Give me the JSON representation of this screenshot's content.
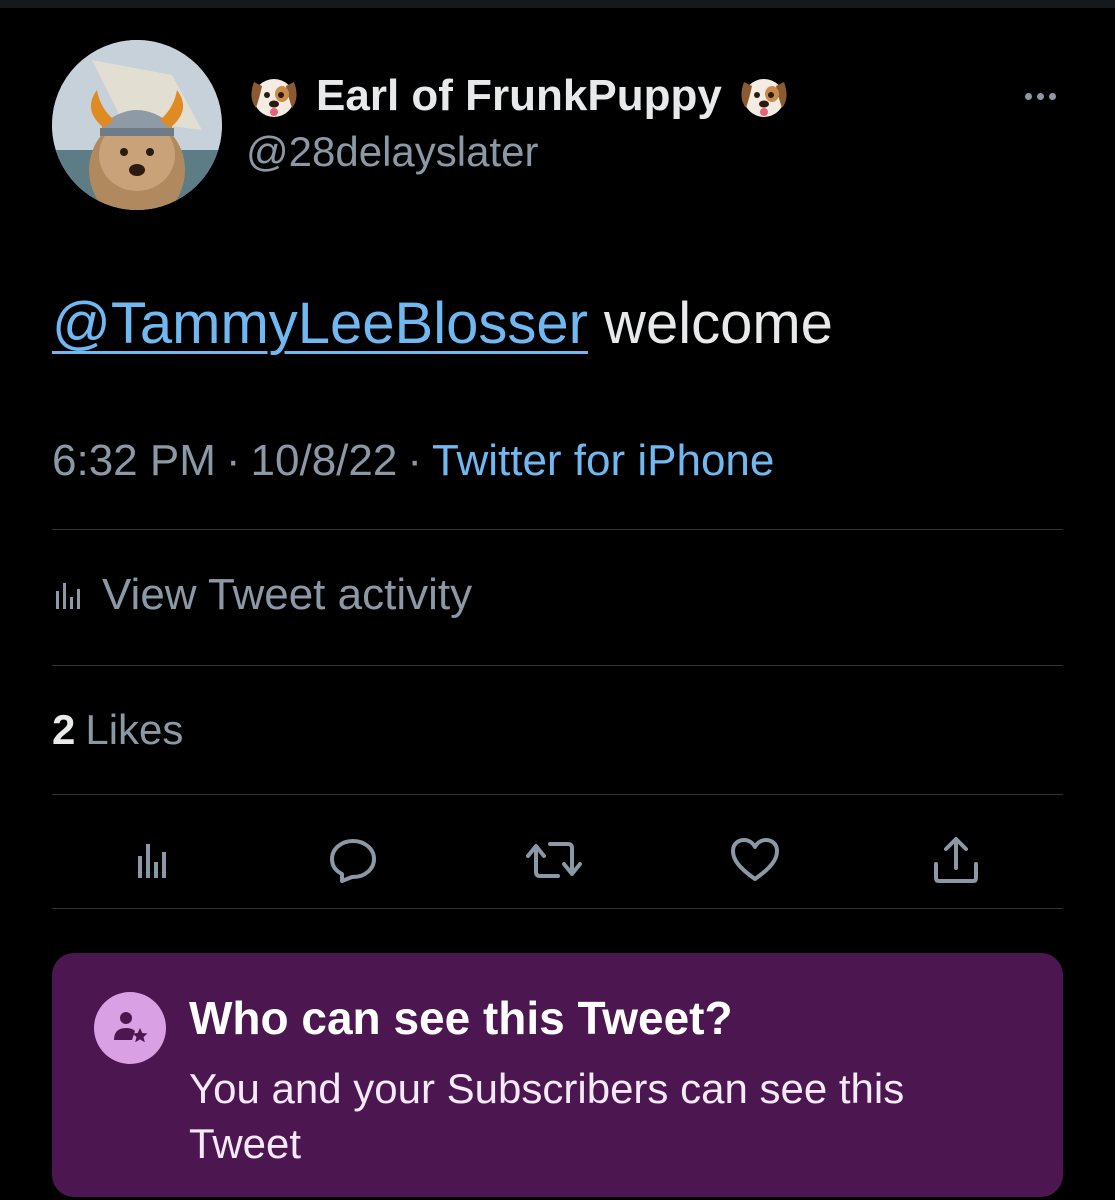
{
  "author": {
    "name_prefix_emoji": "dog-face",
    "display_name": "Earl of FrunkPuppy",
    "name_suffix_emoji": "dog-face",
    "handle": "@28delayslater"
  },
  "more_icon": "more-horizontal-icon",
  "tweet": {
    "mention": "@TammyLeeBlosser",
    "text": " welcome"
  },
  "meta": {
    "time": "6:32 PM",
    "separator": "·",
    "date": "10/8/22",
    "source": "Twitter for iPhone"
  },
  "activity": {
    "icon": "analytics-icon",
    "label": "View Tweet activity"
  },
  "likes": {
    "count": "2",
    "label": "Likes"
  },
  "actions": [
    {
      "icon": "analytics-icon"
    },
    {
      "icon": "reply-icon"
    },
    {
      "icon": "retweet-icon"
    },
    {
      "icon": "like-icon"
    },
    {
      "icon": "share-icon"
    }
  ],
  "audience": {
    "icon": "subscriber-icon",
    "title": "Who can see this Tweet?",
    "description": "You and your Subscribers can see this Tweet"
  },
  "colors": {
    "background": "#000000",
    "text_primary": "#e7e9ea",
    "text_secondary": "#8b98a5",
    "link": "#6fb8f2",
    "divider": "#2f3336",
    "audience_bg": "#4c1650",
    "audience_icon_bg": "#d9a1e3"
  }
}
